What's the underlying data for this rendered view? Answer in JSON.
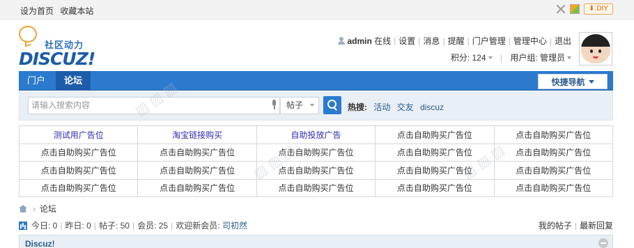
{
  "topbar": {
    "set_home": "设为首页",
    "bookmark": "收藏本站",
    "diy_label": "⬇ DIY"
  },
  "logo": {
    "slogan": "社区动力",
    "brand": "DISCUZ!"
  },
  "user": {
    "name": "admin",
    "online": "在线",
    "links": [
      "设置",
      "消息",
      "提醒",
      "门户管理",
      "管理中心",
      "退出"
    ],
    "points": "积分: 124",
    "group": "用户组: 管理员"
  },
  "nav": {
    "tabs": [
      "门户",
      "论坛"
    ],
    "quick_nav": "快捷导航"
  },
  "search": {
    "placeholder": "请输入搜索内容",
    "type": "帖子",
    "hot_label": "热搜:",
    "hot_keywords": [
      "活动",
      "交友",
      "discuz"
    ]
  },
  "ads": {
    "rows": [
      [
        "测试用广告位",
        "淘宝链接购买",
        "自助投放广告",
        "点击自助购买广告位",
        "点击自助购买广告位"
      ],
      [
        "点击自助购买广告位",
        "点击自助购买广告位",
        "点击自助购买广告位",
        "点击自助购买广告位",
        "点击自助购买广告位"
      ],
      [
        "点击自助购买广告位",
        "点击自助购买广告位",
        "点击自助购买广告位",
        "点击自助购买广告位",
        "点击自助购买广告位"
      ],
      [
        "点击自助购买广告位",
        "点击自助购买广告位",
        "点击自助购买广告位",
        "点击自助购买广告位",
        "点击自助购买广告位"
      ]
    ]
  },
  "breadcrumb": {
    "current": "论坛"
  },
  "stats": {
    "today": "今日: 0",
    "yesterday": "昨日: 0",
    "posts": "帖子: 50",
    "members": "会员: 25",
    "welcome": "欢迎新会员:",
    "newest": "司初然"
  },
  "right_links": {
    "my_posts": "我的帖子",
    "latest": "最新回复"
  },
  "forum": {
    "section_title": "Discuz!"
  },
  "colors": {
    "nav_blue": "#2b7acd",
    "link_blue": "#2b5d8f"
  }
}
